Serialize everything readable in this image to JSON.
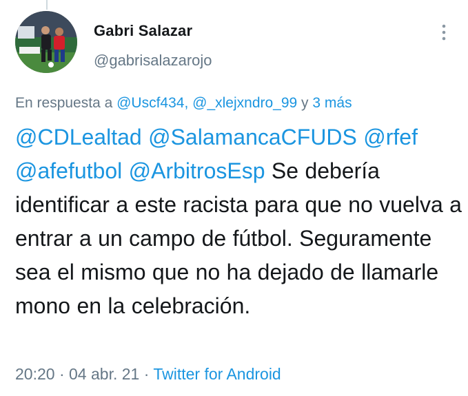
{
  "author": {
    "display_name": "Gabri Salazar",
    "handle": "@gabrisalazarojo",
    "avatar_icon": "avatar-photo"
  },
  "reply": {
    "prefix": "En respuesta a",
    "users": "@Uscf434, @_xlejxndro_99",
    "connector": " y ",
    "more": "3 más"
  },
  "tweet": {
    "mentions": [
      "@CDLealtad",
      "@SalamancaCFUDS",
      "@rfef",
      "@afefutbol",
      "@ArbitrosEsp"
    ],
    "body": "Se debería identificar a este racista para que no vuelva a entrar a un campo de fútbol. Seguramente sea el mismo que no ha dejado de llamarle mono en la celebración."
  },
  "meta": {
    "time": "20:20",
    "separator": " · ",
    "date": "04 abr. 21",
    "source": "Twitter for Android"
  },
  "icons": {
    "more": "more-vertical-icon"
  },
  "colors": {
    "link": "#1b95e0",
    "secondary_text": "#657786",
    "primary_text": "#14171a"
  }
}
